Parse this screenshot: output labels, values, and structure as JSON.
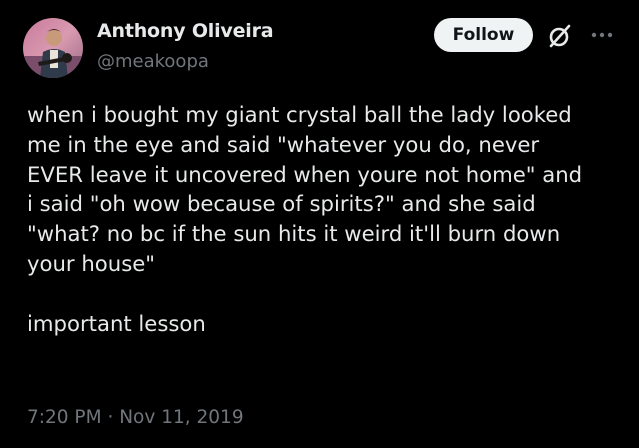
{
  "author": {
    "name": "Anthony Oliveira",
    "handle": "@meakoopa"
  },
  "actions": {
    "follow_label": "Follow",
    "grok_icon": "grok-slash-circle-icon",
    "more_icon": "ellipsis-icon"
  },
  "tweet": {
    "lines": [
      "when i bought my giant crystal ball the lady looked",
      "me in the eye and said \"whatever you do, never",
      "EVER leave it uncovered when youre not home\" and",
      "i said \"oh wow because of spirits?\" and she said",
      "\"what? no bc if the sun hits it weird it'll burn down",
      "your house\"",
      "important lesson"
    ],
    "time": "7:20 PM",
    "separator": "·",
    "date": "Nov 11, 2019"
  },
  "colors": {
    "background": "#000000",
    "primary_text": "#e7e9ea",
    "secondary_text": "#71767b",
    "follow_bg": "#eff3f4",
    "follow_text": "#0f1419"
  }
}
